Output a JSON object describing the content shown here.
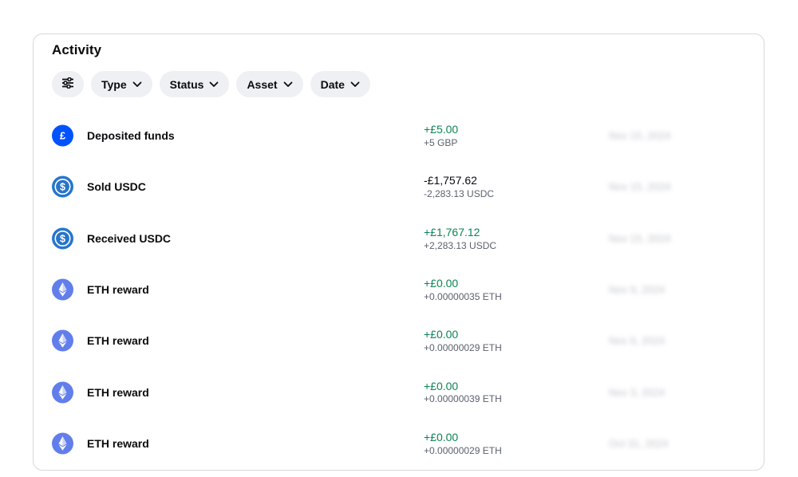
{
  "activity": {
    "title": "Activity",
    "filters": [
      {
        "label": "Type"
      },
      {
        "label": "Status"
      },
      {
        "label": "Asset"
      },
      {
        "label": "Date"
      }
    ],
    "filter_icon": "sliders-icon",
    "rows": [
      {
        "label": "Deposited funds",
        "icon": "pound-icon",
        "fiat": "+£5.00",
        "crypto": "+5 GBP",
        "date": "Nov 15, 2024",
        "positive": true
      },
      {
        "label": "Sold USDC",
        "icon": "usdc-icon",
        "fiat": "-£1,757.62",
        "crypto": "-2,283.13 USDC",
        "date": "Nov 15, 2024",
        "positive": false
      },
      {
        "label": "Received USDC",
        "icon": "usdc-icon",
        "fiat": "+£1,767.12",
        "crypto": "+2,283.13 USDC",
        "date": "Nov 15, 2024",
        "positive": true
      },
      {
        "label": "ETH reward",
        "icon": "eth-icon",
        "fiat": "+£0.00",
        "crypto": "+0.00000035 ETH",
        "date": "Nov 9, 2024",
        "positive": true
      },
      {
        "label": "ETH reward",
        "icon": "eth-icon",
        "fiat": "+£0.00",
        "crypto": "+0.00000029 ETH",
        "date": "Nov 6, 2024",
        "positive": true
      },
      {
        "label": "ETH reward",
        "icon": "eth-icon",
        "fiat": "+£0.00",
        "crypto": "+0.00000039 ETH",
        "date": "Nov 3, 2024",
        "positive": true
      },
      {
        "label": "ETH reward",
        "icon": "eth-icon",
        "fiat": "+£0.00",
        "crypto": "+0.00000029 ETH",
        "date": "Oct 31, 2024",
        "positive": true
      }
    ]
  },
  "colors": {
    "positive": "#098551",
    "pound_blue": "#0052ff",
    "usdc_blue": "#2775ca",
    "eth_purple": "#627eea",
    "chip_bg": "#eef0f3"
  }
}
